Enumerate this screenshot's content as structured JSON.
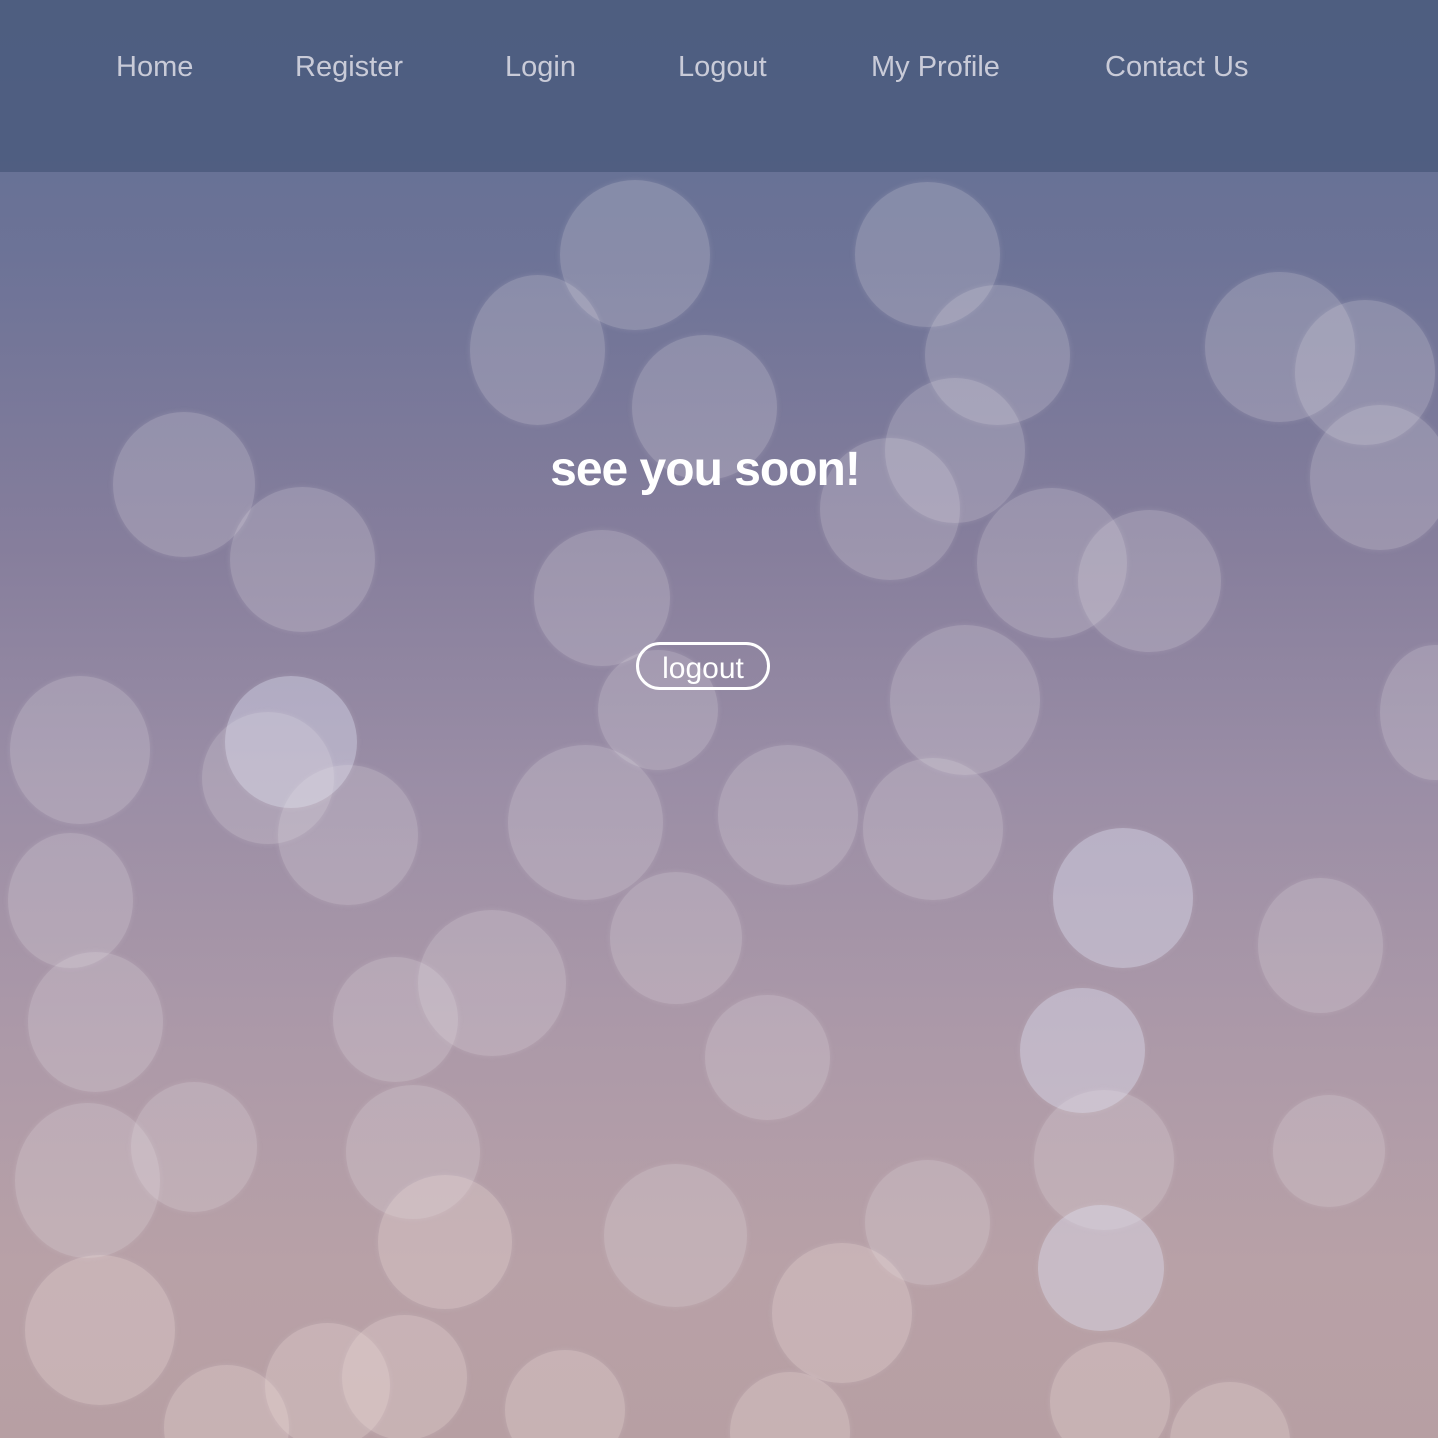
{
  "nav": {
    "items": [
      {
        "label": "Home"
      },
      {
        "label": "Register"
      },
      {
        "label": "Login"
      },
      {
        "label": "Logout"
      },
      {
        "label": "My Profile"
      },
      {
        "label": "Contact Us"
      }
    ]
  },
  "main": {
    "heading": "see you soon!",
    "logout_button": "logout"
  },
  "colors": {
    "navbar": "#4f5d80",
    "nav_text": "#c9cbd8",
    "heading": "#ffffff",
    "button_border": "#ffffff"
  }
}
